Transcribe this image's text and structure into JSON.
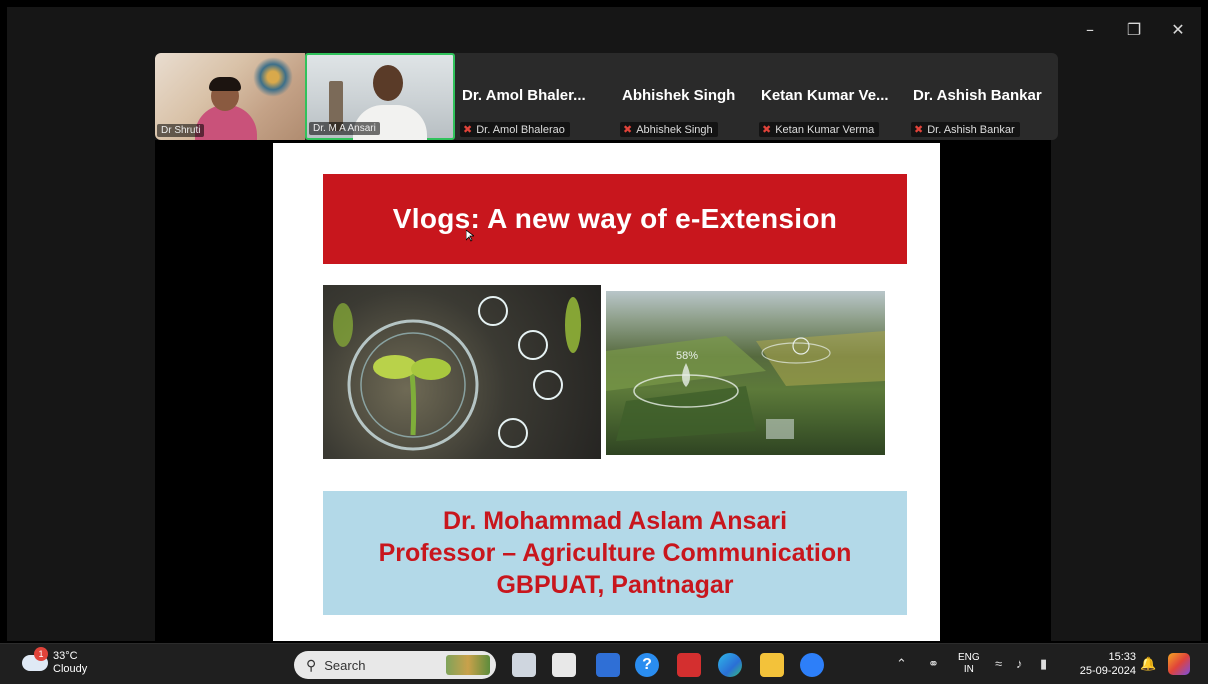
{
  "window": {
    "minimize_icon": "minimize-icon",
    "restore_icon": "restore-icon",
    "close_icon": "close-icon"
  },
  "gallery": {
    "video_tiles": [
      {
        "name": "Dr Shruti"
      },
      {
        "name": "Dr. M A Ansari"
      }
    ],
    "name_tiles": [
      {
        "display": "Dr. Amol Bhaler...",
        "label": "Dr. Amol Bhalerao"
      },
      {
        "display": "Abhishek Singh",
        "label": "Abhishek Singh"
      },
      {
        "display": "Ketan Kumar Ve...",
        "label": "Ketan Kumar Verma"
      },
      {
        "display": "Dr. Ashish Bankar",
        "label": "Dr. Ashish Bankar"
      }
    ],
    "next_icon": "chevron-right-icon"
  },
  "slide": {
    "title": "Vlogs: A new way of e-Extension",
    "author_lines": [
      "Dr. Mohammad Aslam Ansari",
      "Professor – Agriculture Communication",
      "GBPUAT, Pantnagar"
    ],
    "overlay_percent": "58%",
    "colors": {
      "banner": "#c8161d",
      "author_bg": "#b3d9e8",
      "author_text": "#c8161d"
    }
  },
  "taskbar": {
    "weather": {
      "badge": "1",
      "temp": "33°C",
      "condition": "Cloudy"
    },
    "search_placeholder": "Search",
    "apps": [
      "file-explorer-icon",
      "store-icon",
      "app-icon",
      "help-icon",
      "mcafee-icon",
      "edge-icon",
      "folder-icon",
      "zoom-icon"
    ],
    "lang": {
      "line1": "ENG",
      "line2": "IN"
    },
    "time": "15:33",
    "date": "25-09-2024"
  }
}
